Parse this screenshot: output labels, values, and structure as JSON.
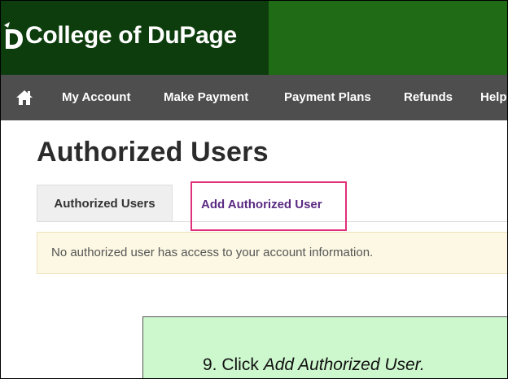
{
  "header": {
    "brand_name": "College of DuPage",
    "colors": {
      "brand_bg": "#0d3d0d",
      "header_bg": "#1f6b16",
      "nav_bg": "#4e4e4e"
    }
  },
  "nav": {
    "home_icon": "home-icon",
    "items": [
      {
        "label": "My Account"
      },
      {
        "label": "Make Payment"
      },
      {
        "label": "Payment Plans"
      },
      {
        "label": "Refunds"
      },
      {
        "label": "Help"
      }
    ]
  },
  "page": {
    "title": "Authorized Users",
    "tabs": [
      {
        "label": "Authorized Users",
        "active": true
      },
      {
        "label": "Add Authorized User",
        "highlighted": true
      }
    ],
    "notice": "No authorized user has access to your account information."
  },
  "callout": {
    "prefix": "9. Click ",
    "emphasis": "Add Authorized User."
  },
  "colors": {
    "highlight_border": "#e0307a",
    "link_color": "#5a2a82",
    "notice_bg": "#fcf8e3",
    "callout_bg": "#cdf7cd"
  }
}
